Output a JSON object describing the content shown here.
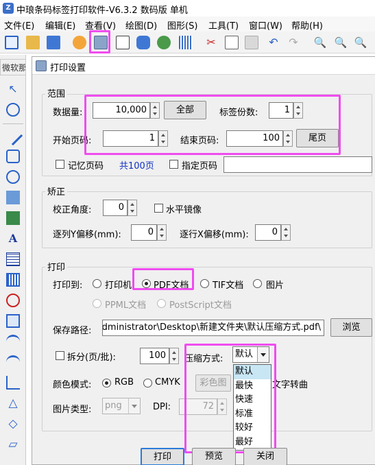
{
  "window": {
    "title": "中琅条码标签打印软件-V6.3.2 数码版 单机"
  },
  "menubar": [
    "文件(E)",
    "编辑(E)",
    "查看(V)",
    "绘图(D)",
    "图形(S)",
    "工具(T)",
    "窗口(W)",
    "帮助(H)"
  ],
  "sidetab": {
    "label": "微软那"
  },
  "dialog": {
    "title": "打印设置",
    "range": {
      "title": "范围",
      "data_qty_label": "数据量:",
      "data_qty_value": "10,000",
      "all_button": "全部",
      "copies_label": "标签份数:",
      "copies_value": "1",
      "start_page_label": "开始页码:",
      "start_page_value": "1",
      "end_page_label": "结束页码:",
      "end_page_value": "100",
      "last_page_button": "尾页",
      "remember_label": "记忆页码",
      "total_pages": "共100页",
      "specify_label": "指定页码"
    },
    "correction": {
      "title": "矫正",
      "angle_label": "校正角度:",
      "angle_value": "0",
      "mirror_label": "水平镜像",
      "y_offset_label": "逐列Y偏移(mm):",
      "y_offset_value": "0",
      "x_offset_label": "逐行X偏移(mm):",
      "x_offset_value": "0"
    },
    "print": {
      "title": "打印",
      "print_to_label": "打印到:",
      "targets": {
        "printer": "打印机",
        "pdf": "PDF文档",
        "tif": "TIF文档",
        "image": "图片",
        "ppml": "PPML文档",
        "postscript": "PostScript文档"
      },
      "save_path_label": "保存路径:",
      "save_path_value": "\\Administrator\\Desktop\\新建文件夹\\默认压缩方式.pdf",
      "browse_button": "浏览",
      "split_label": "拆分(页/批):",
      "split_value": "100",
      "compress_label": "压缩方式:",
      "compress_value": "默认",
      "compress_options": [
        "默认",
        "最快",
        "快速",
        "标准",
        "较好",
        "最好"
      ],
      "color_mode_label": "颜色模式:",
      "rgb_label": "RGB",
      "cmyk_label": "CMYK",
      "spot_color_button": "彩色图",
      "text_curve_label": "文字转曲",
      "image_type_label": "图片类型:",
      "image_type_value": "png",
      "dpi_label": "DPI:",
      "dpi_value": "72"
    },
    "footer": {
      "print_button": "打印",
      "preview_button": "预览",
      "close_button": "关闭"
    }
  },
  "colors": {
    "highlight": "#f04cf0",
    "selected_option": "#c8e6f4"
  }
}
